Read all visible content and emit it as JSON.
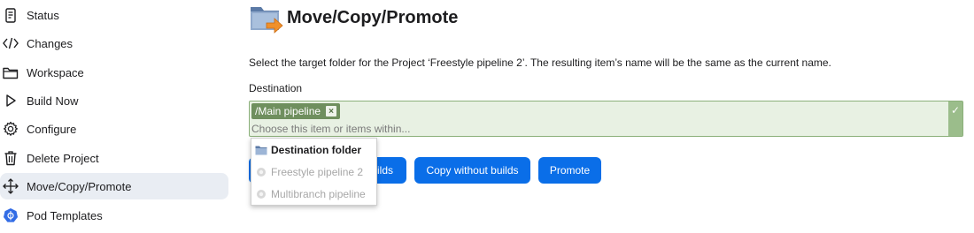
{
  "sidebar": {
    "items": [
      {
        "label": "Status",
        "icon": "document-icon"
      },
      {
        "label": "Changes",
        "icon": "code-icon"
      },
      {
        "label": "Workspace",
        "icon": "folder-icon"
      },
      {
        "label": "Build Now",
        "icon": "play-icon"
      },
      {
        "label": "Configure",
        "icon": "gear-icon"
      },
      {
        "label": "Delete Project",
        "icon": "trash-icon"
      },
      {
        "label": "Move/Copy/Promote",
        "icon": "move-icon",
        "active": true
      },
      {
        "label": "Pod Templates",
        "icon": "kubernetes-icon"
      }
    ]
  },
  "main": {
    "title": "Move/Copy/Promote",
    "description": "Select the target folder for the Project ‘Freestyle pipeline 2’. The resulting item’s name will be the same as the current name.",
    "destination_label": "Destination",
    "selected_chip": "/Main pipeline",
    "chip_remove": "×",
    "input_placeholder": "Choose this item or items within...",
    "buttons": {
      "move_with_builds_tail": "ilds",
      "copy_without_builds": "Copy without builds",
      "promote": "Promote"
    }
  },
  "dropdown": {
    "header": "Destination folder",
    "items": [
      "Freestyle pipeline 2",
      "Multibranch pipeline"
    ]
  },
  "colors": {
    "accent": "#0a6ee8",
    "valid_bg": "#e8f1e3",
    "chip": "#6f8f5e",
    "active_nav": "#e9edf3"
  }
}
